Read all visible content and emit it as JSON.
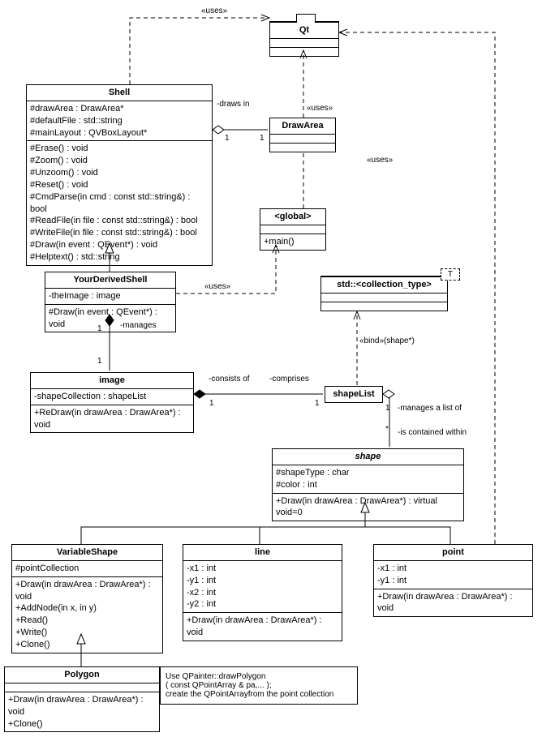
{
  "qt": {
    "name": "Qt"
  },
  "shell": {
    "name": "Shell",
    "attrs": [
      "#drawArea : DrawArea*",
      "#defaultFile : std::string",
      "#mainLayout : QVBoxLayout*"
    ],
    "ops": [
      "#Erase() : void",
      "#Zoom() : void",
      "#Unzoom() : void",
      "#Reset() : void",
      "#CmdParse(in cmd : const std::string&) : bool",
      "#ReadFile(in file : const std::string&) : bool",
      "#WriteFile(in file : const std::string&) : bool",
      "#Draw(in event : QEvent*) : void",
      "#Helptext() : std::string"
    ]
  },
  "drawarea": {
    "name": "DrawArea"
  },
  "global": {
    "name": "<global>",
    "ops": [
      "+main()"
    ]
  },
  "yourshell": {
    "name": "YourDerivedShell",
    "attrs": [
      "-theImage : image"
    ],
    "ops": [
      "#Draw(in event : QEvent*) : void"
    ]
  },
  "coll": {
    "name": "std::<collection_type>",
    "param": "T"
  },
  "image": {
    "name": "image",
    "attrs": [
      "-shapeCollection : shapeList"
    ],
    "ops": [
      "+ReDraw(in drawArea : DrawArea*) : void"
    ]
  },
  "shapelist": {
    "name": "shapeList"
  },
  "shape": {
    "name": "shape",
    "attrs": [
      "#shapeType : char",
      "#color : int"
    ],
    "ops": [
      "+Draw(in drawArea : DrawArea*) : virtual void=0"
    ]
  },
  "varshape": {
    "name": "VariableShape",
    "attrs": [
      "#pointCollection"
    ],
    "ops": [
      "+Draw(in drawArea : DrawArea*) : void",
      "+AddNode(in x, in y)",
      "+Read()",
      "+Write()",
      "+Clone()"
    ]
  },
  "line": {
    "name": "line",
    "attrs": [
      "-x1 : int",
      "-y1 : int",
      "-x2 : int",
      "-y2 : int"
    ],
    "ops": [
      "+Draw(in drawArea : DrawArea*) : void"
    ]
  },
  "point": {
    "name": "point",
    "attrs": [
      "-x1 : int",
      "-y1 : int"
    ],
    "ops": [
      "+Draw(in drawArea : DrawArea*) : void"
    ]
  },
  "polygon": {
    "name": "Polygon",
    "ops": [
      "+Draw(in drawArea : DrawArea*) : void",
      "+Clone()"
    ]
  },
  "note": {
    "l1": "Use QPainter::drawPolygon",
    "l2": "( const QPointArray & pa,... );",
    "l3": "create the QPointArrayfrom the point collection"
  },
  "labels": {
    "uses": "«uses»",
    "drawsin": "-draws in",
    "manages": "-manages",
    "consistsof": "-consists of",
    "comprises": "-comprises",
    "managesalist": "-manages a list of",
    "containedwithin": "-is contained within",
    "bind": "«bind»(shape*)",
    "one": "1",
    "star": "*"
  },
  "chart_data": {
    "type": "uml-class-diagram",
    "classes": [
      {
        "name": "Qt",
        "stereotype": "package"
      },
      {
        "name": "Shell",
        "attributes": [
          "#drawArea : DrawArea*",
          "#defaultFile : std::string",
          "#mainLayout : QVBoxLayout*"
        ],
        "operations": [
          "#Erase() : void",
          "#Zoom() : void",
          "#Unzoom() : void",
          "#Reset() : void",
          "#CmdParse(in cmd : const std::string&) : bool",
          "#ReadFile(in file : const std::string&) : bool",
          "#WriteFile(in file : const std::string&) : bool",
          "#Draw(in event : QEvent*) : void",
          "#Helptext() : std::string"
        ]
      },
      {
        "name": "DrawArea"
      },
      {
        "name": "<global>",
        "operations": [
          "+main()"
        ]
      },
      {
        "name": "YourDerivedShell",
        "attributes": [
          "-theImage : image"
        ],
        "operations": [
          "#Draw(in event : QEvent*) : void"
        ]
      },
      {
        "name": "std::<collection_type>",
        "template": "T"
      },
      {
        "name": "image",
        "attributes": [
          "-shapeCollection : shapeList"
        ],
        "operations": [
          "+ReDraw(in drawArea : DrawArea*) : void"
        ]
      },
      {
        "name": "shapeList"
      },
      {
        "name": "shape",
        "abstract": true,
        "attributes": [
          "#shapeType : char",
          "#color : int"
        ],
        "operations": [
          "+Draw(in drawArea : DrawArea*) : virtual void=0"
        ]
      },
      {
        "name": "VariableShape",
        "attributes": [
          "#pointCollection"
        ],
        "operations": [
          "+Draw(in drawArea : DrawArea*) : void",
          "+AddNode(in x, in y)",
          "+Read()",
          "+Write()",
          "+Clone()"
        ]
      },
      {
        "name": "line",
        "attributes": [
          "-x1 : int",
          "-y1 : int",
          "-x2 : int",
          "-y2 : int"
        ],
        "operations": [
          "+Draw(in drawArea : DrawArea*) : void"
        ]
      },
      {
        "name": "point",
        "attributes": [
          "-x1 : int",
          "-y1 : int"
        ],
        "operations": [
          "+Draw(in drawArea : DrawArea*) : void"
        ]
      },
      {
        "name": "Polygon",
        "operations": [
          "+Draw(in drawArea : DrawArea*) : void",
          "+Clone()"
        ]
      }
    ],
    "relationships": [
      {
        "from": "Shell",
        "to": "Qt",
        "type": "dependency",
        "label": "«uses»"
      },
      {
        "from": "DrawArea",
        "to": "Qt",
        "type": "dependency",
        "label": "«uses»"
      },
      {
        "from": "<global>",
        "to": "Qt",
        "type": "dependency",
        "label": "«uses»"
      },
      {
        "from": "point",
        "to": "Qt",
        "type": "dependency",
        "label": "«uses»"
      },
      {
        "from": "Shell",
        "to": "DrawArea",
        "type": "aggregation",
        "label": "-draws in",
        "mult": {
          "from": "1",
          "to": "1"
        }
      },
      {
        "from": "YourDerivedShell",
        "to": "Shell",
        "type": "generalization"
      },
      {
        "from": "YourDerivedShell",
        "to": "<global>",
        "type": "dependency",
        "label": "«uses»"
      },
      {
        "from": "YourDerivedShell",
        "to": "image",
        "type": "composition",
        "label": "-manages",
        "mult": {
          "from": "1",
          "to": "1"
        }
      },
      {
        "from": "image",
        "to": "shapeList",
        "type": "composition",
        "label": "-consists of / -comprises",
        "mult": {
          "from": "1",
          "to": "1"
        }
      },
      {
        "from": "shapeList",
        "to": "std::<collection_type>",
        "type": "dependency",
        "label": "«bind»(shape*)"
      },
      {
        "from": "shapeList",
        "to": "shape",
        "type": "aggregation",
        "label": "-manages a list of / -is contained within",
        "mult": {
          "from": "1",
          "to": "*"
        }
      },
      {
        "from": "VariableShape",
        "to": "shape",
        "type": "generalization"
      },
      {
        "from": "line",
        "to": "shape",
        "type": "generalization"
      },
      {
        "from": "point",
        "to": "shape",
        "type": "generalization"
      },
      {
        "from": "Polygon",
        "to": "VariableShape",
        "type": "generalization"
      }
    ],
    "notes": [
      {
        "text": "Use QPainter::drawPolygon ( const QPointArray & pa,... ); create the QPointArrayfrom the point collection",
        "attachedTo": "Polygon"
      }
    ]
  }
}
